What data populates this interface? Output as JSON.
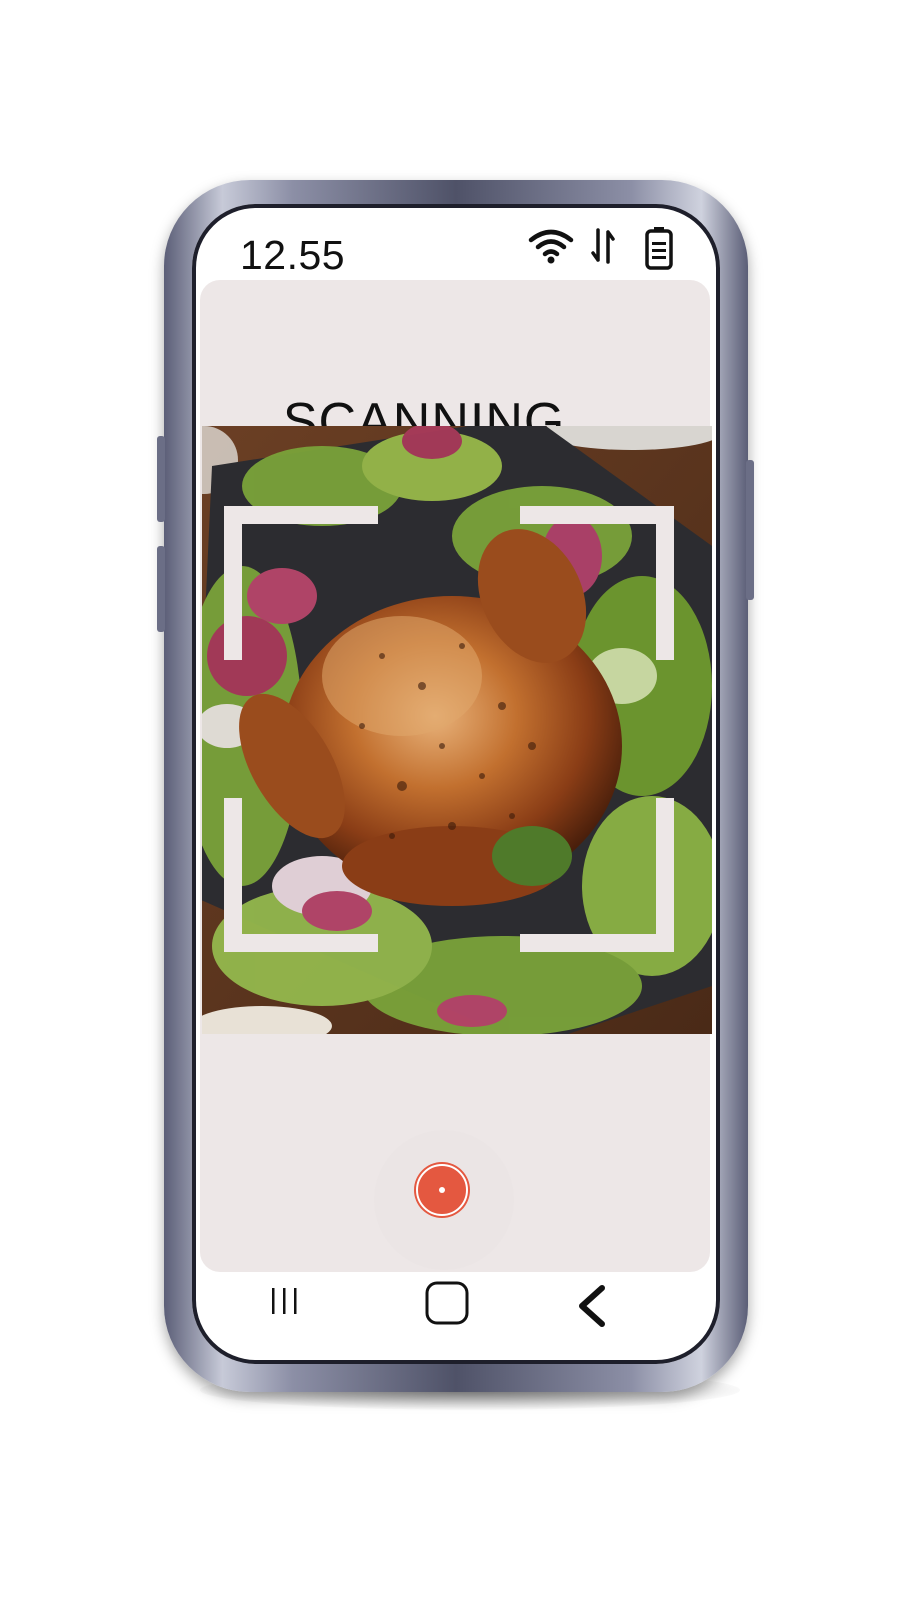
{
  "status_bar": {
    "time": "12.55",
    "icons": [
      "wifi-icon",
      "data-transfer-icon",
      "battery-icon"
    ]
  },
  "scanner": {
    "title": "SCANNING....",
    "image_subject": "roast-chicken-on-salad",
    "capture_button": "shutter-button"
  },
  "navigation": {
    "buttons": [
      "recent-apps",
      "home",
      "back"
    ]
  },
  "colors": {
    "panel": "#ede7e7",
    "capture": "#e45840",
    "frame": "#5b5e77"
  }
}
